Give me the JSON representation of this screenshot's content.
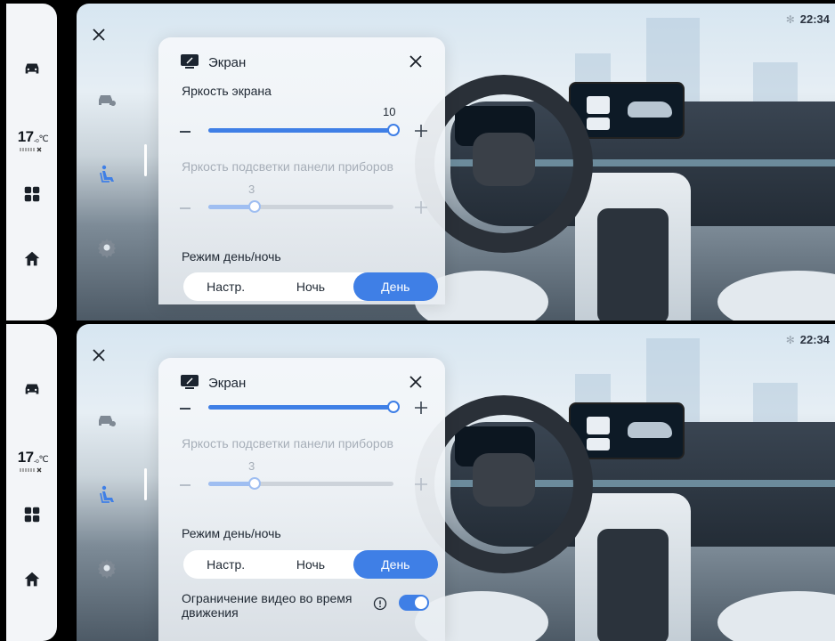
{
  "status": {
    "time": "22:34",
    "bluetooth_icon": "bluetooth-icon"
  },
  "dock": {
    "temperature": "17",
    "temperature_unit": ".₀℃",
    "items": [
      "car-icon",
      "apps-grid-icon",
      "home-icon"
    ]
  },
  "side_menu": [
    "car-settings-icon",
    "seat-icon",
    "gear-icon"
  ],
  "popup": {
    "title": "Экран",
    "brightness": {
      "label": "Яркость экрана",
      "value": "10",
      "level": 1.0
    },
    "panel_backlight": {
      "label": "Яркость подсветки панели приборов",
      "value": "3",
      "level": 0.25
    },
    "day_night": {
      "label": "Режим день/ночь",
      "options": [
        "Настр.",
        "Ночь",
        "День"
      ],
      "selected": "День"
    },
    "video_limit": {
      "label": "Ограничение видео во время движения",
      "enabled": true
    }
  },
  "colors": {
    "accent": "#3f7fe6",
    "dock_bg": "#f3f5f8"
  }
}
